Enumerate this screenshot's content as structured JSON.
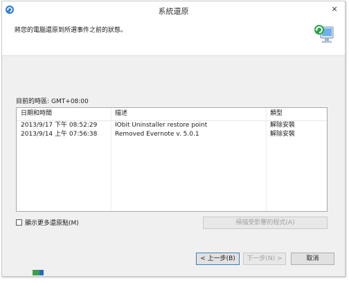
{
  "window": {
    "title": "系統還原",
    "close_glyph": "✕"
  },
  "header": {
    "instruction": "將您的電腦還原到所選事件之前的狀態。"
  },
  "timezone": {
    "label": "目前的時區:",
    "value": "GMT+08:00"
  },
  "table": {
    "columns": [
      "日期和時間",
      "描述",
      "類型"
    ],
    "rows": [
      {
        "date": "2013/9/17 下午 08:52:29",
        "description": "IObit Uninstaller restore point",
        "type": "解除安裝"
      },
      {
        "date": "2013/9/14 上午 07:56:38",
        "description": "Removed Evernote v. 5.0.1",
        "type": "解除安裝"
      }
    ]
  },
  "show_more": {
    "label": "顯示更多還原點(M)",
    "checked": false
  },
  "buttons": {
    "scan": "掃描受影響的程式(A)",
    "back": "< 上一步(B)",
    "next": "下一步(N) >",
    "cancel": "取消"
  }
}
